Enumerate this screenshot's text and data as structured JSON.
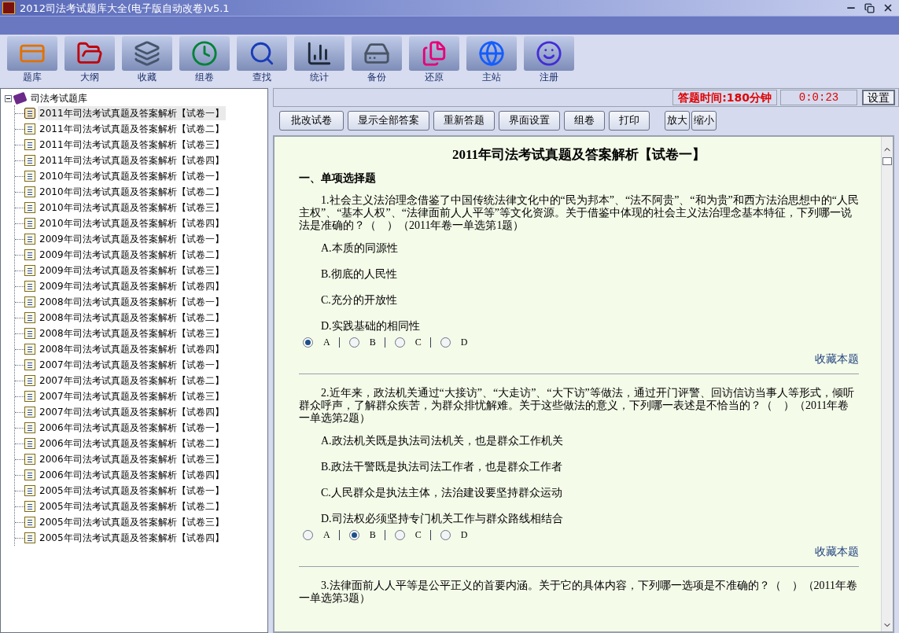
{
  "window": {
    "title": "2012司法考试题库大全(电子版自动改卷)v5.1"
  },
  "toolbar": [
    {
      "label": "题库"
    },
    {
      "label": "大纲"
    },
    {
      "label": "收藏"
    },
    {
      "label": "组卷"
    },
    {
      "label": "查找"
    },
    {
      "label": "统计"
    },
    {
      "label": "备份"
    },
    {
      "label": "还原"
    },
    {
      "label": "主站"
    },
    {
      "label": "注册"
    }
  ],
  "tree": {
    "label": "司法考试题库",
    "expanded": true,
    "children": [
      {
        "label": "2011年司法考试真题及答案解析【试卷一】",
        "selected": true
      },
      {
        "label": "2011年司法考试真题及答案解析【试卷二】",
        "selected": false
      },
      {
        "label": "2011年司法考试真题及答案解析【试卷三】",
        "selected": false
      },
      {
        "label": "2011年司法考试真题及答案解析【试卷四】",
        "selected": false
      },
      {
        "label": "2010年司法考试真题及答案解析【试卷一】",
        "selected": false
      },
      {
        "label": "2010年司法考试真题及答案解析【试卷二】",
        "selected": false
      },
      {
        "label": "2010年司法考试真题及答案解析【试卷三】",
        "selected": false
      },
      {
        "label": "2010年司法考试真题及答案解析【试卷四】",
        "selected": false
      },
      {
        "label": "2009年司法考试真题及答案解析【试卷一】",
        "selected": false
      },
      {
        "label": "2009年司法考试真题及答案解析【试卷二】",
        "selected": false
      },
      {
        "label": "2009年司法考试真题及答案解析【试卷三】",
        "selected": false
      },
      {
        "label": "2009年司法考试真题及答案解析【试卷四】",
        "selected": false
      },
      {
        "label": "2008年司法考试真题及答案解析【试卷一】",
        "selected": false
      },
      {
        "label": "2008年司法考试真题及答案解析【试卷二】",
        "selected": false
      },
      {
        "label": "2008年司法考试真题及答案解析【试卷三】",
        "selected": false
      },
      {
        "label": "2008年司法考试真题及答案解析【试卷四】",
        "selected": false
      },
      {
        "label": "2007年司法考试真题及答案解析【试卷一】",
        "selected": false
      },
      {
        "label": "2007年司法考试真题及答案解析【试卷二】",
        "selected": false
      },
      {
        "label": "2007年司法考试真题及答案解析【试卷三】",
        "selected": false
      },
      {
        "label": "2007年司法考试真题及答案解析【试卷四】",
        "selected": false
      },
      {
        "label": "2006年司法考试真题及答案解析【试卷一】",
        "selected": false
      },
      {
        "label": "2006年司法考试真题及答案解析【试卷二】",
        "selected": false
      },
      {
        "label": "2006年司法考试真题及答案解析【试卷三】",
        "selected": false
      },
      {
        "label": "2006年司法考试真题及答案解析【试卷四】",
        "selected": false
      },
      {
        "label": "2005年司法考试真题及答案解析【试卷一】",
        "selected": false
      },
      {
        "label": "2005年司法考试真题及答案解析【试卷二】",
        "selected": false
      },
      {
        "label": "2005年司法考试真题及答案解析【试卷三】",
        "selected": false
      },
      {
        "label": "2005年司法考试真题及答案解析【试卷四】",
        "selected": false
      }
    ]
  },
  "timer": {
    "label": "答题时间:180分钟",
    "value": "0:0:23"
  },
  "settings_button": "设置",
  "action_buttons": [
    "批改试卷",
    "显示全部答案",
    "重新答题",
    "界面设置",
    "组卷",
    "打印"
  ],
  "zoom_buttons": [
    "放大",
    "缩小"
  ],
  "document": {
    "title": "2011年司法考试真题及答案解析【试卷一】",
    "section": "一、单项选择题",
    "questions": [
      {
        "text": "1.社会主义法治理念借鉴了中国传统法律文化中的“民为邦本”、“法不阿贵”、“和为贵”和西方法治思想中的“人民主权”、“基本人权”、“法律面前人人平等”等文化资源。关于借鉴中体现的社会主义法治理念基本特征，下列哪一说法是准确的？（　）（2011年卷一单选第1题）",
        "options": [
          "A.本质的同源性",
          "B.彻底的人民性",
          "C.充分的开放性",
          "D.实践基础的相同性"
        ],
        "answers": [
          {
            "label": "A",
            "selected": true
          },
          {
            "label": "B",
            "selected": false
          },
          {
            "label": "C",
            "selected": false
          },
          {
            "label": "D",
            "selected": false
          }
        ],
        "favorite_link": "收藏本题"
      },
      {
        "text": "2.近年来，政法机关通过“大接访”、“大走访”、“大下访”等做法，通过开门评警、回访信访当事人等形式，倾听群众呼声，了解群众疾苦，为群众排忧解难。关于这些做法的意义，下列哪一表述是不恰当的？（　）（2011年卷一单选第2题）",
        "options": [
          "A.政法机关既是执法司法机关，也是群众工作机关",
          "B.政法干警既是执法司法工作者，也是群众工作者",
          "C.人民群众是执法主体，法治建设要坚持群众运动",
          "D.司法权必须坚持专门机关工作与群众路线相结合"
        ],
        "answers": [
          {
            "label": "A",
            "selected": false
          },
          {
            "label": "B",
            "selected": true
          },
          {
            "label": "C",
            "selected": false
          },
          {
            "label": "D",
            "selected": false
          }
        ],
        "favorite_link": "收藏本题"
      },
      {
        "text": "3.法律面前人人平等是公平正义的首要内涵。关于它的具体内容，下列哪一选项是不准确的？（　）（2011年卷一单选第3题）"
      }
    ]
  }
}
